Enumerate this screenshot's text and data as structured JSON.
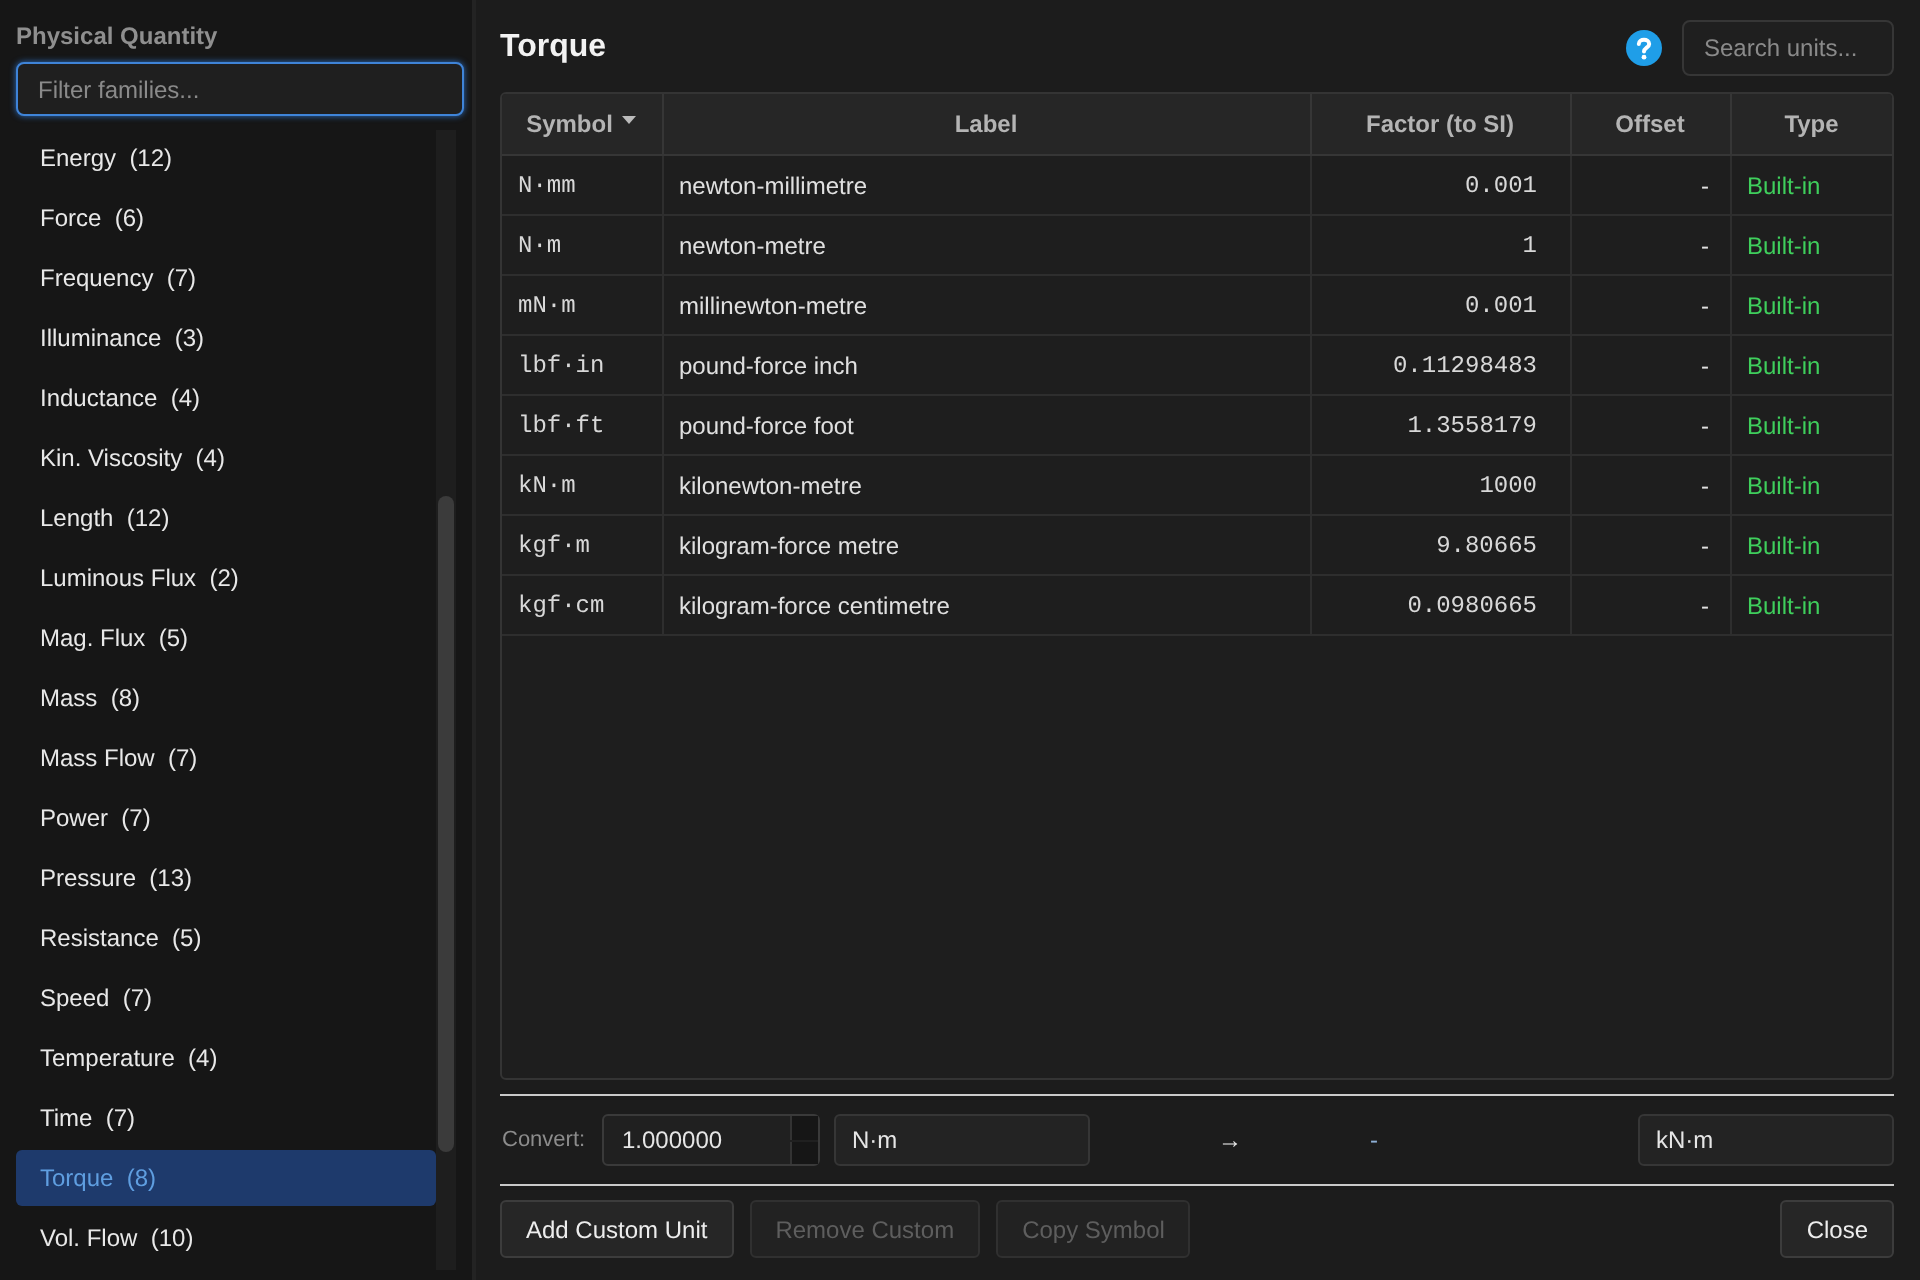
{
  "sidebar": {
    "heading": "Physical Quantity",
    "filter": {
      "placeholder": "Filter families...",
      "focused": true
    },
    "items": [
      {
        "label": "Energy  (12)",
        "selected": false
      },
      {
        "label": "Force  (6)",
        "selected": false
      },
      {
        "label": "Frequency  (7)",
        "selected": false
      },
      {
        "label": "Illuminance  (3)",
        "selected": false
      },
      {
        "label": "Inductance  (4)",
        "selected": false
      },
      {
        "label": "Kin. Viscosity  (4)",
        "selected": false
      },
      {
        "label": "Length  (12)",
        "selected": false
      },
      {
        "label": "Luminous Flux  (2)",
        "selected": false
      },
      {
        "label": "Mag. Flux  (5)",
        "selected": false
      },
      {
        "label": "Mass  (8)",
        "selected": false
      },
      {
        "label": "Mass Flow  (7)",
        "selected": false
      },
      {
        "label": "Power  (7)",
        "selected": false
      },
      {
        "label": "Pressure  (13)",
        "selected": false
      },
      {
        "label": "Resistance  (5)",
        "selected": false
      },
      {
        "label": "Speed  (7)",
        "selected": false
      },
      {
        "label": "Temperature  (4)",
        "selected": false
      },
      {
        "label": "Time  (7)",
        "selected": false
      },
      {
        "label": "Torque  (8)",
        "selected": true
      },
      {
        "label": "Vol. Flow  (10)",
        "selected": false
      }
    ]
  },
  "main": {
    "title": "Torque",
    "search": {
      "placeholder": "Search units..."
    },
    "table": {
      "columns": [
        {
          "label": "Symbol",
          "sorted": true
        },
        {
          "label": "Label",
          "sorted": false
        },
        {
          "label": "Factor (to SI)",
          "sorted": false
        },
        {
          "label": "Offset",
          "sorted": false
        },
        {
          "label": "Type",
          "sorted": false
        }
      ],
      "rows": [
        [
          "N·mm",
          "newton-millimetre",
          "0.001",
          "-",
          "Built-in"
        ],
        [
          "N·m",
          "newton-metre",
          "1",
          "-",
          "Built-in"
        ],
        [
          "mN·m",
          "millinewton-metre",
          "0.001",
          "-",
          "Built-in"
        ],
        [
          "lbf·in",
          "pound-force inch",
          "0.11298483",
          "-",
          "Built-in"
        ],
        [
          "lbf·ft",
          "pound-force foot",
          "1.3558179",
          "-",
          "Built-in"
        ],
        [
          "kN·m",
          "kilonewton-metre",
          "1000",
          "-",
          "Built-in"
        ],
        [
          "kgf·m",
          "kilogram-force metre",
          "9.80665",
          "-",
          "Built-in"
        ],
        [
          "kgf·cm",
          "kilogram-force centimetre",
          "0.0980665",
          "-",
          "Built-in"
        ]
      ]
    },
    "convert": {
      "label": "Convert:",
      "value": "1.000000",
      "from": "N·m",
      "arrow": "→",
      "result": "-",
      "to": "kN·m"
    },
    "buttons": [
      {
        "label": "Add Custom Unit",
        "disabled": false,
        "kind": "left"
      },
      {
        "label": "Remove Custom",
        "disabled": true,
        "kind": "left"
      },
      {
        "label": "Copy Symbol",
        "disabled": true,
        "kind": "left"
      },
      {
        "label": "Close",
        "disabled": false,
        "kind": "right"
      }
    ]
  }
}
